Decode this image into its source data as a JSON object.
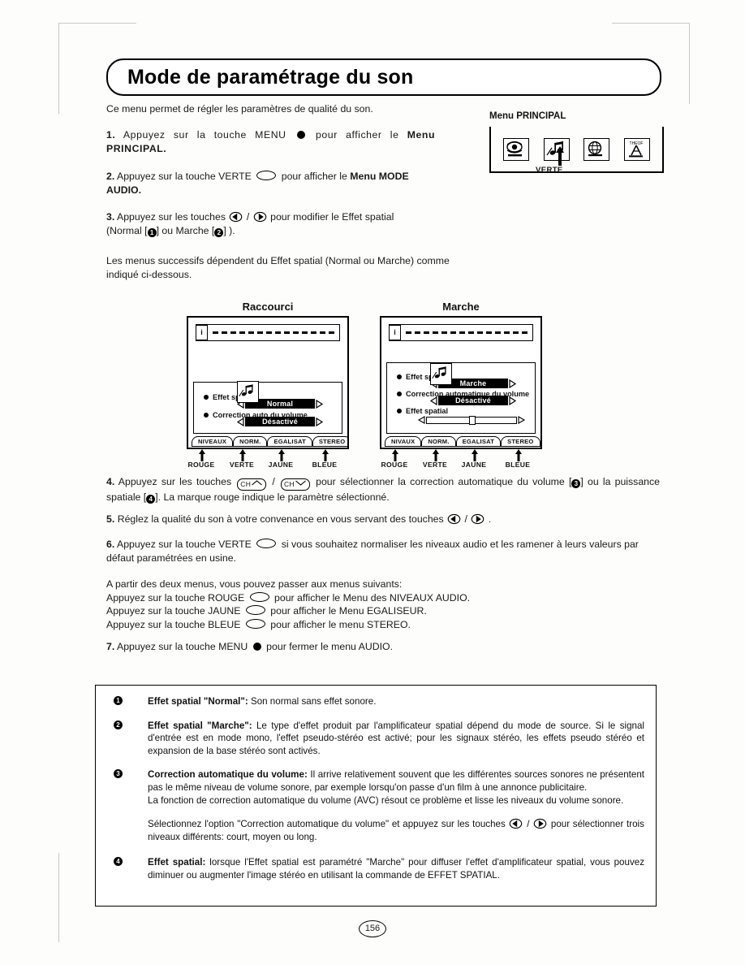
{
  "title": "Mode de paramétrage du son",
  "intro": "Ce menu permet de régler les paramètres de qualité du son.",
  "steps": {
    "s1_num": "1.",
    "s1_a": "Appuyez sur la touche MENU",
    "s1_b": "pour afficher le",
    "s1_bold": "Menu PRINCIPAL.",
    "s2_num": "2.",
    "s2_a": "Appuyez sur la touche VERTE",
    "s2_b": "pour afficher le",
    "s2_bold": "Menu MODE AUDIO.",
    "s3_num": "3.",
    "s3_a": "Appuyez sur les touches",
    "s3_b": "pour modifier le Effet spatial",
    "s3_c": "(Normal [",
    "s3_d": "] ou Marche [",
    "s3_e": "] ).",
    "succ": "Les menus successifs dépendent du Effet spatial (Normal ou Marche) comme indiqué ci-dessous.",
    "s4_num": "4.",
    "s4_a": "Appuyez sur les touches",
    "s4_b": "pour sélectionner la correction automatique du volume [",
    "s4_c": "] ou la puissance spatiale [",
    "s4_d": "]. La marque rouge indique le paramètre sélectionné.",
    "s5_num": "5.",
    "s5_a": "Réglez la qualité du son à votre convenance en vous servant des touches",
    "s5_b": ".",
    "s6_num": "6.",
    "s6_a": "Appuyez sur la touche VERTE",
    "s6_b": "si vous souhaitez normaliser les niveaux audio et les ramener à leurs valeurs par défaut paramétrées en usine.",
    "s7_num": "7.",
    "s7_a": "Appuyez sur la touche MENU",
    "s7_b": "pour fermer le menu AUDIO."
  },
  "menulist": {
    "lead": "A partir des deux menus, vous pouvez passer aux menus suivants:",
    "rows": [
      {
        "pre": "Appuyez sur la touche ROUGE",
        "post": "pour afficher le Menu des NIVEAUX AUDIO."
      },
      {
        "pre": "Appuyez sur la touche JAUNE",
        "post": "pour afficher le Menu EGALISEUR."
      },
      {
        "pre": "Appuyez sur la touche BLEUE",
        "post": "pour afficher le menu STEREO."
      }
    ]
  },
  "principal": {
    "caption": "Menu PRINCIPAL",
    "icons": [
      "picture-eye-icon",
      "audio-note-icon",
      "globe-clock-icon",
      "antenna-icon"
    ],
    "marker_label": "VERTE"
  },
  "diagrams": [
    {
      "caption": "Raccourci",
      "osd_info": "i",
      "rows": [
        {
          "label": "Effet spatial:",
          "value": "Normal"
        },
        {
          "label": "Correction auto du volume",
          "value": "Désactivé"
        }
      ],
      "slider": null,
      "tabs": [
        "NIVEAUX",
        "NORM.",
        "EGALISAT",
        "STEREO"
      ],
      "colors": [
        "ROUGE",
        "VERTE",
        "JAUNE",
        "BLEUE"
      ]
    },
    {
      "caption": "Marche",
      "osd_info": "i",
      "rows": [
        {
          "label": "Effet spatial:",
          "value": "Marche"
        },
        {
          "label": "Correction automatique du volume",
          "value": "Désactivé"
        }
      ],
      "slider": {
        "label": "Effet spatial",
        "position": 50
      },
      "tabs": [
        "NIVAUX",
        "NORM.",
        "EGALISAT",
        "STEREO"
      ],
      "colors": [
        "ROUGE",
        "VERTE",
        "JAUNE",
        "BLEUE"
      ]
    }
  ],
  "notes": [
    {
      "mark": "1",
      "title": "Effet spatial \"Normal\":",
      "body": " Son normal sans effet sonore."
    },
    {
      "mark": "2",
      "title": "Effet spatial \"Marche\":",
      "body": " Le type d'effet produit par l'amplificateur spatial dépend du mode de source. Si le signal d'entrée est en mode mono, l'effet pseudo-stéréo est activé; pour les signaux stéréo, les effets pseudo stéréo et expansion de la base stéréo sont activés."
    },
    {
      "mark": "3",
      "title": "Correction automatique du volume:",
      "body": " Il arrive relativement souvent que les différentes sources sonores ne présentent pas le même niveau de volume sonore, par exemple lorsqu'on passe d'un film à une annonce publicitaire.",
      "body2": "La fonction de correction automatique du volume (AVC) résout ce problème et lisse les niveaux du volume sonore.",
      "body3_a": "Sélectionnez l'option \"Correction automatique du volume\" et appuyez sur les touches",
      "body3_b": "pour sélectionner trois niveaux différents: court, moyen ou long."
    },
    {
      "mark": "4",
      "title": "Effet spatial:",
      "body": " lorsque l'Effet spatial est paramétré \"Marche\" pour diffuser l'effet d'amplificateur spatial, vous pouvez diminuer ou augmenter l'image stéréo en utilisant la commande de EFFET SPATIAL."
    }
  ],
  "page_number": "156"
}
